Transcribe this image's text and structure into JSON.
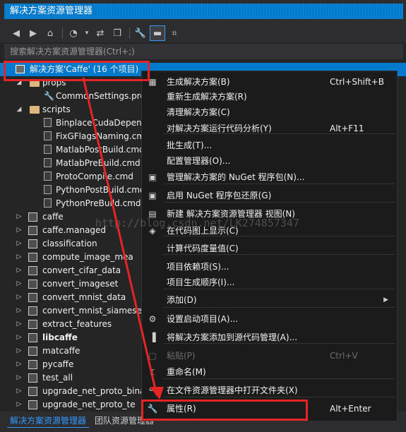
{
  "window": {
    "title": "解决方案资源管理器"
  },
  "toolbar": {
    "icons": [
      "back-icon",
      "forward-icon",
      "home-icon",
      "history-icon",
      "dropdown-icon",
      "sync-icon",
      "properties-icon",
      "collapse-icon",
      "view-icon"
    ]
  },
  "search": {
    "placeholder": "搜索解决方案资源管理器(Ctrl+;)"
  },
  "tree": {
    "solution": "解决方案'Caffe' (16 个项目)",
    "items": [
      {
        "label": "props",
        "type": "folder",
        "level": 1,
        "expanded": true
      },
      {
        "label": "CommonSettings.pro",
        "type": "settings",
        "level": 2
      },
      {
        "label": "scripts",
        "type": "folder",
        "level": 1,
        "expanded": true
      },
      {
        "label": "BinplaceCudaDepend",
        "type": "file",
        "level": 2
      },
      {
        "label": "FixGFlagsNaming.cm",
        "type": "file",
        "level": 2
      },
      {
        "label": "MatlabPostBuild.cmd",
        "type": "file",
        "level": 2
      },
      {
        "label": "MatlabPreBuild.cmd",
        "type": "file",
        "level": 2
      },
      {
        "label": "ProtoCompile.cmd",
        "type": "file",
        "level": 2
      },
      {
        "label": "PythonPostBuild.cmd",
        "type": "file",
        "level": 2
      },
      {
        "label": "PythonPreBuild.cmd",
        "type": "file",
        "level": 2
      },
      {
        "label": "caffe",
        "type": "project",
        "level": 1
      },
      {
        "label": "caffe.managed",
        "type": "project",
        "level": 1
      },
      {
        "label": "classification",
        "type": "project",
        "level": 1
      },
      {
        "label": "compute_image_mea",
        "type": "project",
        "level": 1
      },
      {
        "label": "convert_cifar_data",
        "type": "project",
        "level": 1
      },
      {
        "label": "convert_imageset",
        "type": "project",
        "level": 1
      },
      {
        "label": "convert_mnist_data",
        "type": "project",
        "level": 1
      },
      {
        "label": "convert_mnist_siamese_c",
        "type": "project",
        "level": 1
      },
      {
        "label": "extract_features",
        "type": "project",
        "level": 1
      },
      {
        "label": "libcaffe",
        "type": "project",
        "level": 1,
        "bold": true
      },
      {
        "label": "matcaffe",
        "type": "project",
        "level": 1
      },
      {
        "label": "pycaffe",
        "type": "project",
        "level": 1
      },
      {
        "label": "test_all",
        "type": "project",
        "level": 1
      },
      {
        "label": "upgrade_net_proto_bina",
        "type": "project",
        "level": 1
      },
      {
        "label": "upgrade_net_proto_te",
        "type": "project",
        "level": 1
      }
    ]
  },
  "context_menu": {
    "items": [
      {
        "label": "生成解决方案(B)",
        "shortcut": "Ctrl+Shift+B",
        "icon": "build-icon"
      },
      {
        "label": "重新生成解决方案(R)",
        "shortcut": ""
      },
      {
        "label": "清理解决方案(C)",
        "shortcut": ""
      },
      {
        "label": "对解决方案运行代码分析(Y)",
        "shortcut": "Alt+F11"
      },
      {
        "label": "批生成(T)...",
        "shortcut": ""
      },
      {
        "label": "配置管理器(O)...",
        "shortcut": ""
      },
      {
        "label": "管理解决方案的 NuGet 程序包(N)...",
        "shortcut": "",
        "icon": "nuget-icon"
      },
      {
        "label": "启用 NuGet 程序包还原(G)",
        "shortcut": "",
        "icon": "nuget-restore-icon"
      },
      {
        "label": "新建 解决方案资源管理器 视图(N)",
        "shortcut": "",
        "icon": "new-view-icon"
      },
      {
        "label": "在代码图上显示(C)",
        "shortcut": "",
        "icon": "codemap-icon"
      },
      {
        "label": "计算代码度量值(C)",
        "shortcut": ""
      },
      {
        "label": "项目依赖项(S)...",
        "shortcut": ""
      },
      {
        "label": "项目生成顺序(I)...",
        "shortcut": ""
      },
      {
        "label": "添加(D)",
        "shortcut": "",
        "submenu": true
      },
      {
        "label": "设置启动项目(A)...",
        "shortcut": "",
        "icon": "startup-icon"
      },
      {
        "label": "将解决方案添加到源代码管理(A)...",
        "shortcut": "",
        "icon": "source-control-icon"
      },
      {
        "label": "粘贴(P)",
        "shortcut": "Ctrl+V",
        "disabled": true,
        "icon": "paste-icon"
      },
      {
        "label": "重命名(M)",
        "shortcut": "",
        "icon": "rename-icon"
      },
      {
        "label": "在文件资源管理器中打开文件夹(X)",
        "shortcut": "",
        "icon": "open-folder-icon"
      },
      {
        "label": "属性(R)",
        "shortcut": "Alt+Enter",
        "icon": "wrench-icon"
      }
    ]
  },
  "bottom_tabs": {
    "active": "解决方案资源管理器",
    "inactive": "团队资源管理器"
  },
  "watermark": "http://blog.csdn.net/LK274857347",
  "annotation_color": "#e52525"
}
